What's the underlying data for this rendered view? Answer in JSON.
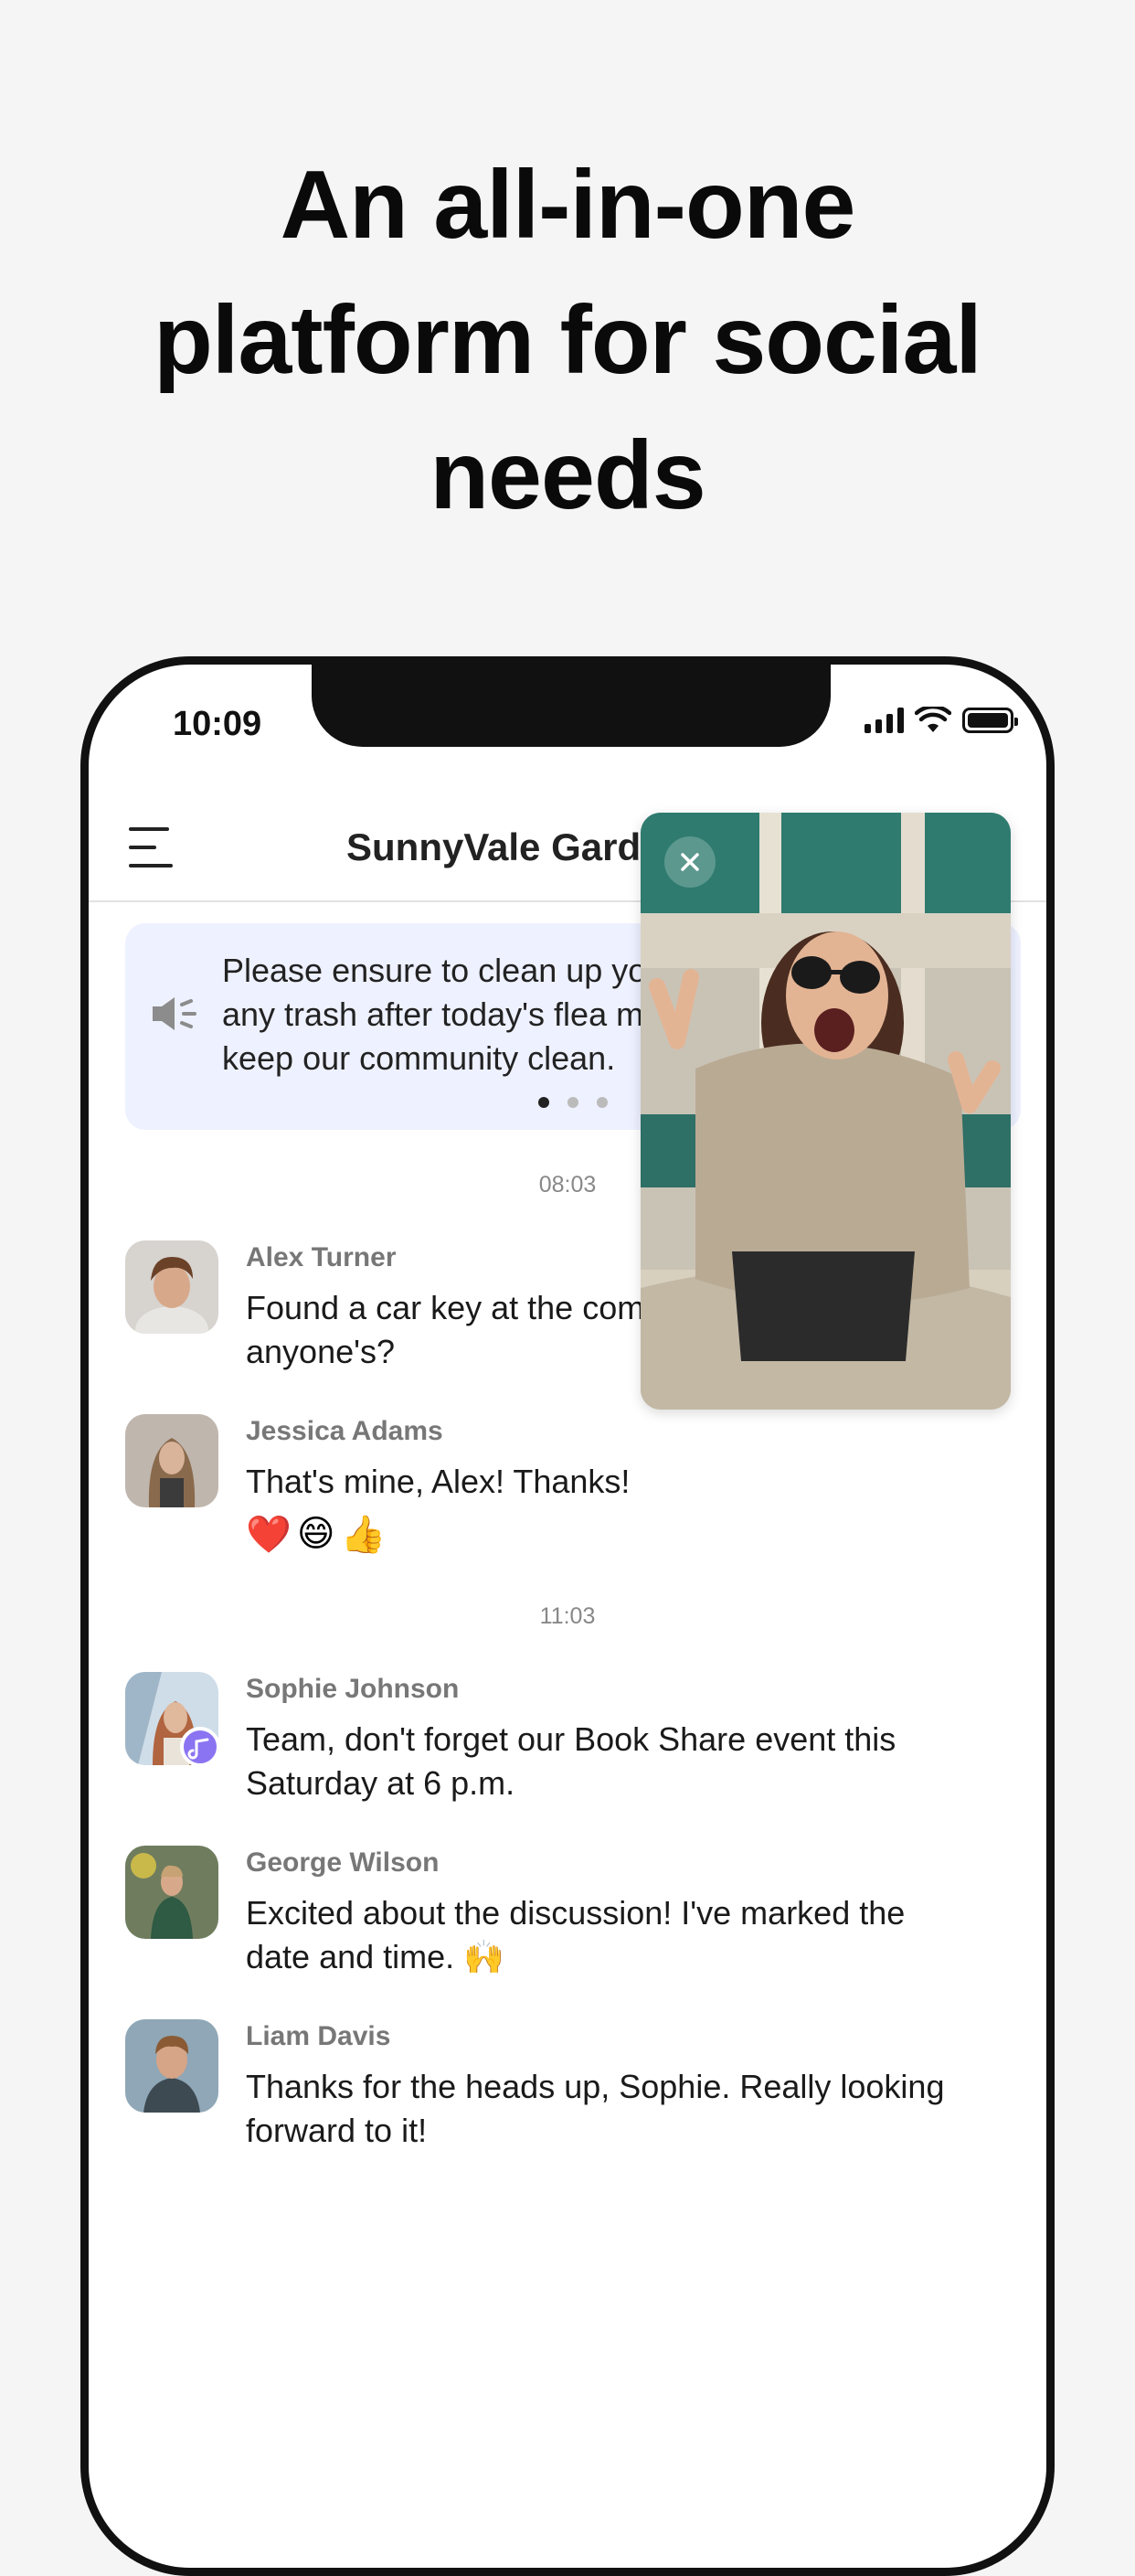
{
  "headline": {
    "line1": "An all-in-one",
    "line2": "platform for social",
    "line3": "needs"
  },
  "status_bar": {
    "time": "10:09"
  },
  "header": {
    "title": "SunnyVale Garde"
  },
  "announcement": {
    "line1": "Please ensure to clean up you",
    "line2": "any trash after today's flea m",
    "line3": "keep our community clean.",
    "page_count": 3,
    "active_page": 1
  },
  "timestamps": [
    "08:03",
    "11:03"
  ],
  "messages": [
    {
      "name": "Alex Turner",
      "line1": "Found a car key at the comm",
      "line2": "anyone's?"
    },
    {
      "name": "Jessica Adams",
      "line1": "That's mine, Alex! Thanks!",
      "emoji": [
        "❤️",
        "😄",
        "👍"
      ]
    },
    {
      "name": "Sophie Johnson",
      "line1": "Team, don't forget our Book Share event this",
      "line2": "Saturday at 6 p.m."
    },
    {
      "name": "George Wilson",
      "line1": "Excited about the discussion! I've marked the",
      "line2": "date and time. 🙌"
    },
    {
      "name": "Liam Davis",
      "line1": "Thanks for the heads up, Sophie. Really looking",
      "line2": "forward to it!"
    }
  ],
  "colors": {
    "announcement_bg": "#eef1ff",
    "badge": "#8b74f2",
    "page_bg": "#f5f5f5"
  }
}
